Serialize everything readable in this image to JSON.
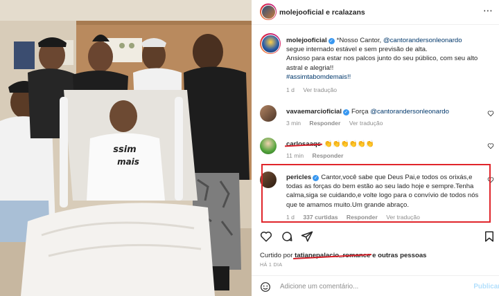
{
  "header": {
    "title": "molejooficial e rcalazans",
    "more_label": "⋯"
  },
  "caption": {
    "username": "molejooficial",
    "text_before_mention": "*Nosso Cantor, ",
    "mention": "@cantorandersonleonardo",
    "line2": "segue internado estável e sem previsão de alta.",
    "line3": "Ansioso para estar nos palcos junto do seu público, com seu alto astral e alegria!!",
    "hashtag": "#assimtabomdemais!!",
    "time": "1 d",
    "translate": "Ver tradução"
  },
  "comments": [
    {
      "username": "vavaemarcioficial",
      "text_before_mention": "Força ",
      "mention": "@cantorandersonleonardo",
      "time": "3 min",
      "reply": "Responder",
      "translate": "Ver tradução"
    },
    {
      "username": "carlosaaqs",
      "emojis": "👏👏👏👏👏👏",
      "time": "11 min",
      "reply": "Responder"
    },
    {
      "username": "pericles",
      "text": "Cantor,você sabe que Deus Pai,e todos os orixás,e todas as forças do bem estão ao seu lado hoje e sempre.Tenha calma,siga se cuidando,e volte logo para o convívio de todos nós que te amamos muito.Um grande abraço.",
      "time": "1 d",
      "likes": "337 curtidas",
      "reply": "Responder",
      "translate": "Ver tradução"
    }
  ],
  "likes": {
    "prefix": "Curtido por ",
    "user": "tatianepalacio_romance",
    "suffix": " e outras pessoas"
  },
  "date": "HÁ 1 DIA",
  "add_comment": {
    "placeholder": "Adicione um comentário...",
    "publish": "Publicar"
  },
  "colors": {
    "highlight_box": "#e0242a",
    "link": "#00376b",
    "verified": "#3897f0"
  }
}
